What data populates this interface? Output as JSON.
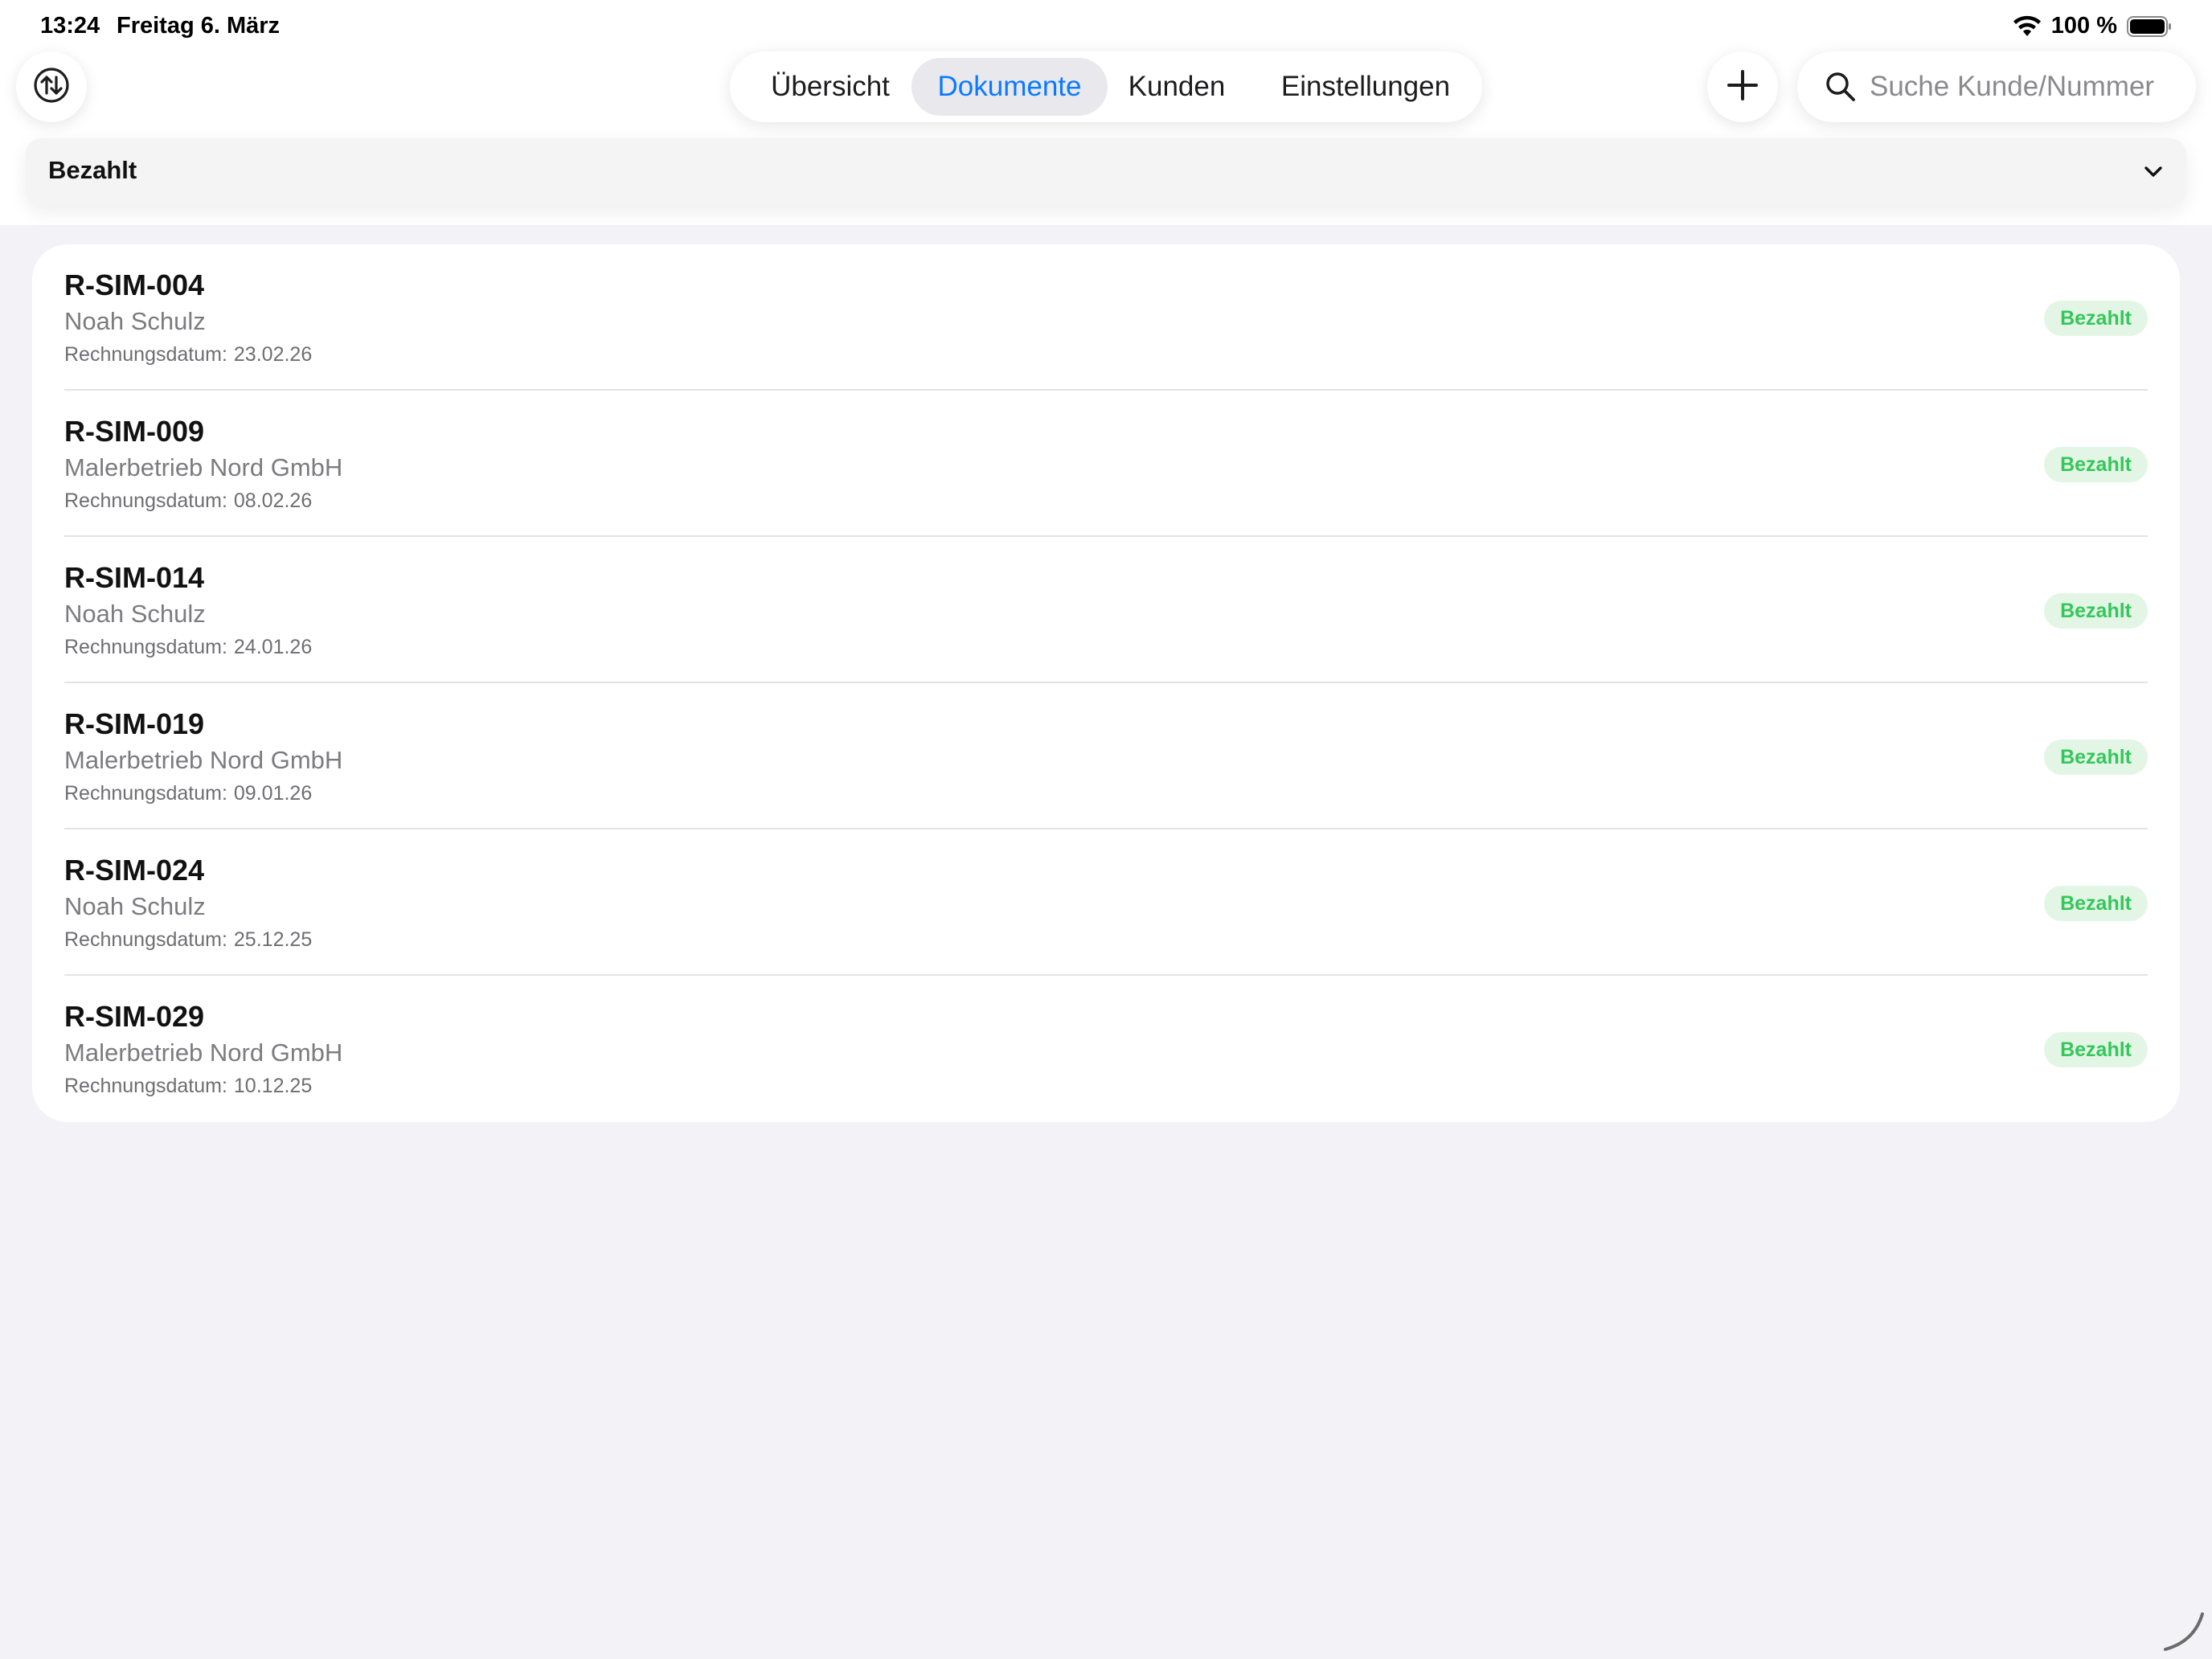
{
  "status_bar": {
    "time": "13:24",
    "date": "Freitag 6. März",
    "battery": "100 %"
  },
  "nav": {
    "tabs": [
      {
        "label": "Übersicht",
        "active": false
      },
      {
        "label": "Dokumente",
        "active": true
      },
      {
        "label": "Kunden",
        "active": false
      },
      {
        "label": "Einstellungen",
        "active": false
      }
    ],
    "search": {
      "placeholder": "Suche Kunde/Nummer",
      "value": ""
    }
  },
  "filter": {
    "selected": "Bezahlt"
  },
  "documents": [
    {
      "number": "R-SIM-004",
      "customer": "Noah Schulz",
      "date_label": "Rechnungsdatum:",
      "date": "23.02.26",
      "status": "Bezahlt"
    },
    {
      "number": "R-SIM-009",
      "customer": "Malerbetrieb Nord GmbH",
      "date_label": "Rechnungsdatum:",
      "date": "08.02.26",
      "status": "Bezahlt"
    },
    {
      "number": "R-SIM-014",
      "customer": "Noah Schulz",
      "date_label": "Rechnungsdatum:",
      "date": "24.01.26",
      "status": "Bezahlt"
    },
    {
      "number": "R-SIM-019",
      "customer": "Malerbetrieb Nord GmbH",
      "date_label": "Rechnungsdatum:",
      "date": "09.01.26",
      "status": "Bezahlt"
    },
    {
      "number": "R-SIM-024",
      "customer": "Noah Schulz",
      "date_label": "Rechnungsdatum:",
      "date": "25.12.25",
      "status": "Bezahlt"
    },
    {
      "number": "R-SIM-029",
      "customer": "Malerbetrieb Nord GmbH",
      "date_label": "Rechnungsdatum:",
      "date": "10.12.25",
      "status": "Bezahlt"
    }
  ],
  "colors": {
    "accent": "#0a7aff",
    "paid_text": "#34c759",
    "paid_bg": "#e3f6e6",
    "background": "#f2f2f7"
  },
  "icons": [
    "sync-icon",
    "plus-icon",
    "search-icon",
    "chevron-down-icon",
    "wifi-icon",
    "battery-icon"
  ]
}
